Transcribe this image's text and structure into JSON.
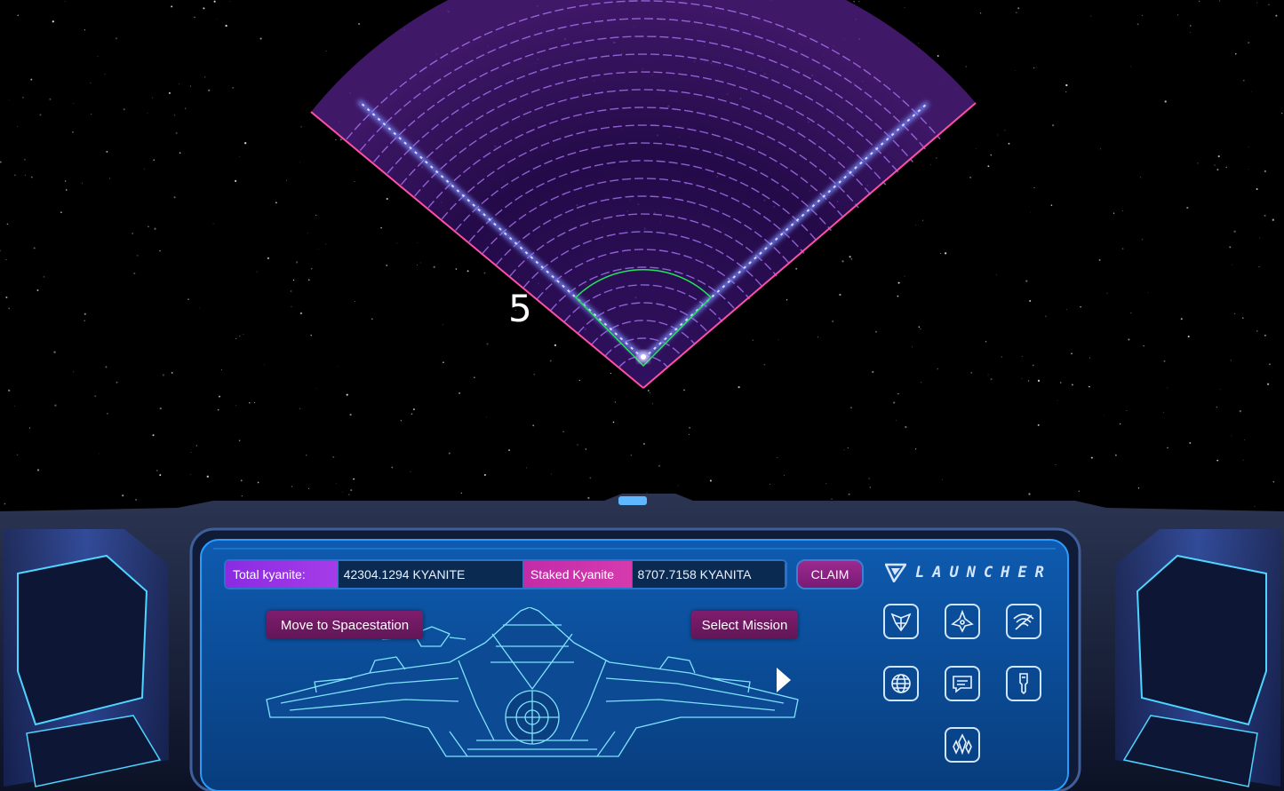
{
  "radar": {
    "number": "5"
  },
  "stats": {
    "total_label": "Total kyanite:",
    "total_value": "42304.1294 KYANITE",
    "staked_label": "Staked Kyanite",
    "staked_value": "8707.7158 KYANITA"
  },
  "actions": {
    "claim_label": "CLAIM",
    "move_label": "Move to Spacestation",
    "select_label": "Select Mission"
  },
  "brand": {
    "name": "LAUNCHER"
  },
  "icons": [
    "fleet-emblem-icon",
    "spaceship-icon",
    "radar-signal-icon",
    "globe-icon",
    "chat-icon",
    "tool-icon",
    "crystal-icon"
  ],
  "colors": {
    "radar_fill": "#2a0a4a",
    "radar_ring": "#b27cff",
    "radar_edge": "#ff4fa8",
    "radar_ray": "#7b8dff",
    "selection_arc": "#22e65a",
    "panel_bg": "#0a4b9a",
    "panel_border": "#2a9cff",
    "button_purple": "#7f1d6e"
  }
}
